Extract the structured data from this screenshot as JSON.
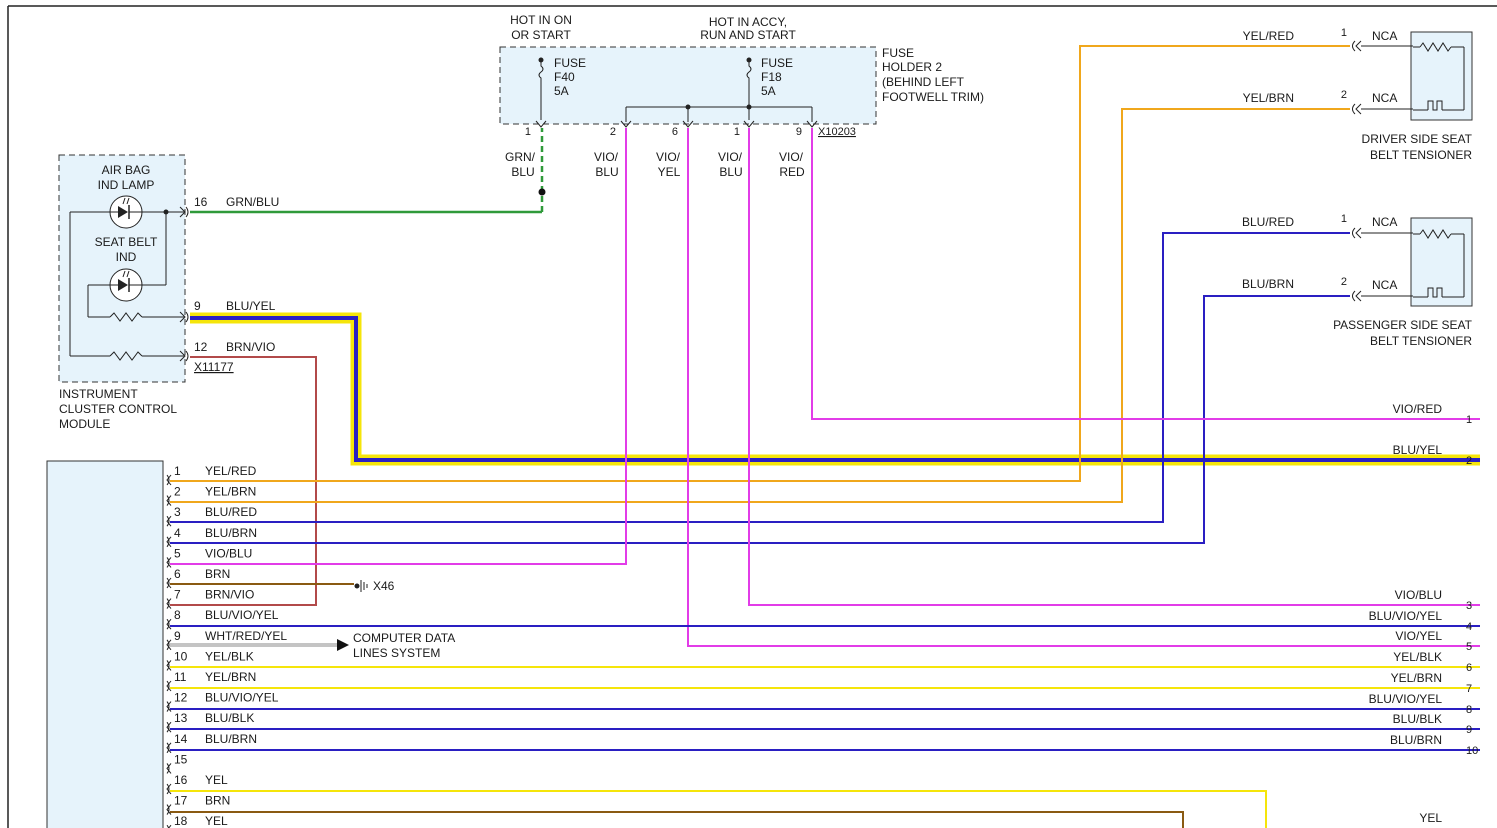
{
  "fuse_block": {
    "hot_on": [
      "HOT IN ON",
      "OR START"
    ],
    "hot_accy": [
      "HOT IN ACCY,",
      "RUN AND START"
    ],
    "title": [
      "FUSE",
      "HOLDER 2",
      "(BEHIND LEFT",
      "FOOTWELL TRIM)"
    ],
    "fuse1": [
      "FUSE",
      "F40",
      "5A"
    ],
    "fuse2": [
      "FUSE",
      "F18",
      "5A"
    ],
    "pins": [
      "1",
      "2",
      "6",
      "1",
      "9"
    ],
    "connector": "X10203",
    "wire_labels": [
      [
        "GRN/",
        "BLU"
      ],
      [
        "VIO/",
        "BLU"
      ],
      [
        "VIO/",
        "YEL"
      ],
      [
        "VIO/",
        "BLU"
      ],
      [
        "VIO/",
        "RED"
      ]
    ]
  },
  "cluster": {
    "airbag_lamp": [
      "AIR BAG",
      "IND LAMP"
    ],
    "seatbelt_ind": [
      "SEAT BELT",
      "IND"
    ],
    "name": [
      "INSTRUMENT",
      "CLUSTER CONTROL",
      "MODULE"
    ],
    "connector": "X11177",
    "pins": [
      {
        "pin": "16",
        "wire": "GRN/BLU"
      },
      {
        "pin": "9",
        "wire": "BLU/YEL"
      },
      {
        "pin": "12",
        "wire": "BRN/VIO"
      }
    ]
  },
  "tensioners": {
    "driver": {
      "name": [
        "DRIVER SIDE SEAT",
        "BELT TENSIONER"
      ],
      "pins": [
        {
          "pin": "1",
          "wire": "YEL/RED",
          "nca": "NCA"
        },
        {
          "pin": "2",
          "wire": "YEL/BRN",
          "nca": "NCA"
        }
      ]
    },
    "passenger": {
      "name": [
        "PASSENGER SIDE SEAT",
        "BELT TENSIONER"
      ],
      "pins": [
        {
          "pin": "1",
          "wire": "BLU/RED",
          "nca": "NCA"
        },
        {
          "pin": "2",
          "wire": "BLU/BRN",
          "nca": "NCA"
        }
      ]
    }
  },
  "module_pins": [
    {
      "pin": "1",
      "wire": "YEL/RED"
    },
    {
      "pin": "2",
      "wire": "YEL/BRN"
    },
    {
      "pin": "3",
      "wire": "BLU/RED"
    },
    {
      "pin": "4",
      "wire": "BLU/BRN"
    },
    {
      "pin": "5",
      "wire": "VIO/BLU"
    },
    {
      "pin": "6",
      "wire": "BRN"
    },
    {
      "pin": "7",
      "wire": "BRN/VIO"
    },
    {
      "pin": "8",
      "wire": "BLU/VIO/YEL"
    },
    {
      "pin": "9",
      "wire": "WHT/RED/YEL"
    },
    {
      "pin": "10",
      "wire": "YEL/BLK"
    },
    {
      "pin": "11",
      "wire": "YEL/BRN"
    },
    {
      "pin": "12",
      "wire": "BLU/VIO/YEL"
    },
    {
      "pin": "13",
      "wire": "BLU/BLK"
    },
    {
      "pin": "14",
      "wire": "BLU/BRN"
    },
    {
      "pin": "15",
      "wire": ""
    },
    {
      "pin": "16",
      "wire": "YEL"
    },
    {
      "pin": "17",
      "wire": "BRN"
    },
    {
      "pin": "18",
      "wire": "YEL"
    }
  ],
  "ground": "X46",
  "data_lines": [
    "COMPUTER DATA",
    "LINES SYSTEM"
  ],
  "right_outputs": [
    {
      "pin": "1",
      "wire": "VIO/RED"
    },
    {
      "pin": "2",
      "wire": "BLU/YEL"
    },
    {
      "pin": "3",
      "wire": "VIO/BLU"
    },
    {
      "pin": "4",
      "wire": "BLU/VIO/YEL"
    },
    {
      "pin": "5",
      "wire": "VIO/YEL"
    },
    {
      "pin": "6",
      "wire": "YEL/BLK"
    },
    {
      "pin": "7",
      "wire": "YEL/BRN"
    },
    {
      "pin": "8",
      "wire": "BLU/VIO/YEL"
    },
    {
      "pin": "9",
      "wire": "BLU/BLK"
    },
    {
      "pin": "10",
      "wire": "BLU/BRN"
    },
    {
      "pin": "",
      "wire": "YEL"
    }
  ],
  "colors": {
    "yellow": "#f5e50a",
    "orange": "#f0a71c",
    "blue": "#2a1fc2",
    "violet": "#e23ce8",
    "green": "#2f9a3a",
    "brown": "#8a5a12",
    "brnvio": "#b24a4a"
  }
}
